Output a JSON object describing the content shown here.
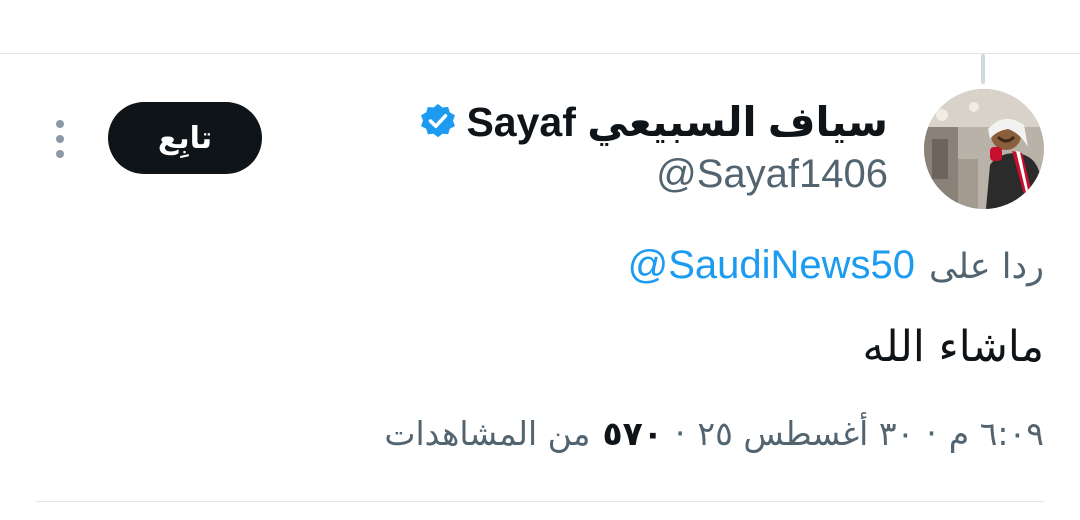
{
  "tweet": {
    "author": {
      "display_name": "سياف السبيعي Sayaf",
      "handle": "@Sayaf1406",
      "verified": true
    },
    "follow_label": "تابِع",
    "reply_prefix": "ردا على",
    "reply_to": "@SaudiNews50",
    "text": "ماشاء الله",
    "meta": {
      "time": "٦:٠٩ م",
      "date": "٣٠ أغسطس ٢٥",
      "separator": "·",
      "views_count": "٥٧٠",
      "views_label": "من المشاهدات"
    }
  },
  "colors": {
    "text_primary": "#0f1419",
    "text_secondary": "#536471",
    "link": "#1d9bf0",
    "verified": "#1d9bf0",
    "button_bg": "#0f1419",
    "divider": "#e1e5e8"
  },
  "icons": [
    "verified-icon",
    "more-icon",
    "avatar"
  ]
}
